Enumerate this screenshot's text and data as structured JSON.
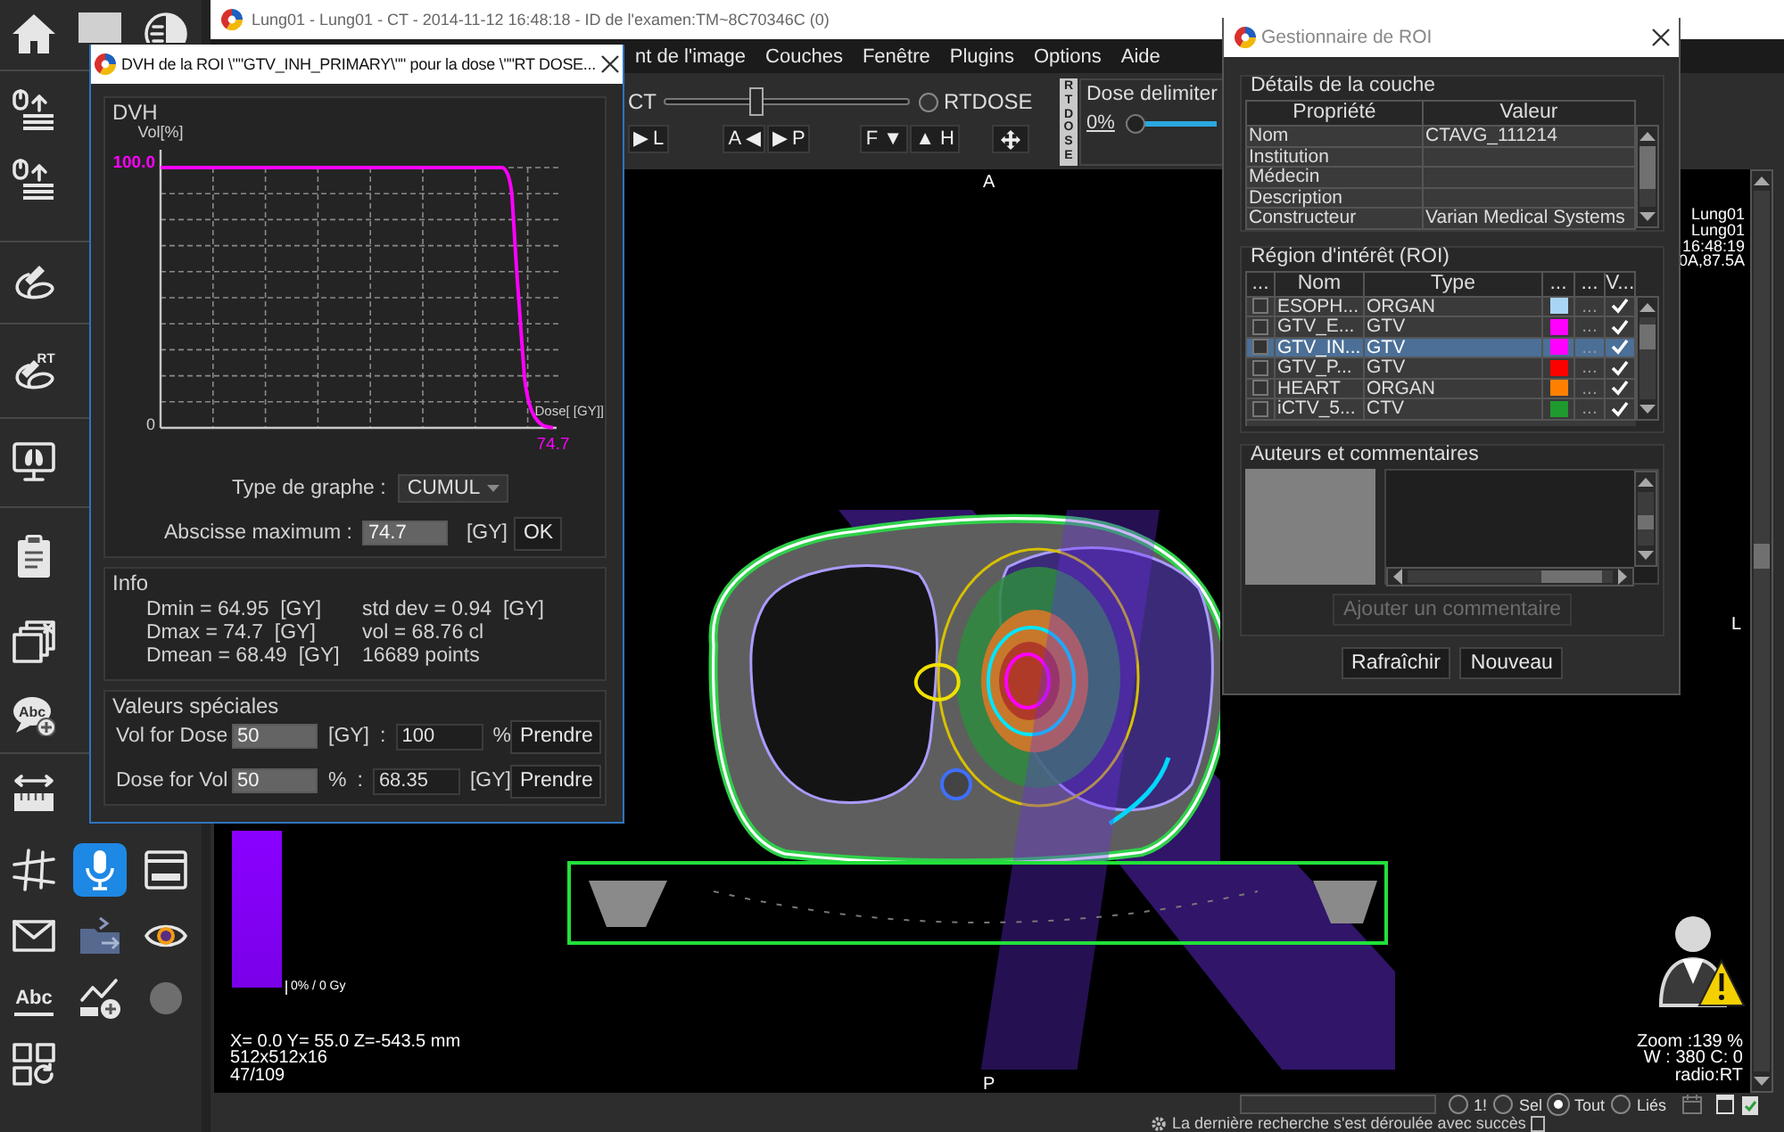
{
  "tool_palette": [
    {
      "kind": "home",
      "selected": false
    },
    {
      "kind": "square",
      "selected": false
    },
    {
      "kind": "contrast",
      "selected": false
    },
    {
      "kind": "stack-upload",
      "selected": false
    },
    {
      "kind": "stack-upload",
      "selected": false
    },
    {
      "kind": "lasso",
      "selected": false
    },
    {
      "kind": "lasso-badge",
      "label": "RT",
      "selected": false
    },
    {
      "kind": "monitor-lungs",
      "selected": false
    },
    {
      "kind": "clipboard",
      "selected": false
    },
    {
      "kind": "stack-close",
      "selected": false
    },
    {
      "kind": "text-bubble-add",
      "label": "Abc",
      "selected": false
    },
    {
      "kind": "ruler",
      "selected": false
    },
    {
      "kind": "angle",
      "selected": false
    },
    {
      "kind": "microphone",
      "selected": true
    },
    {
      "kind": "window",
      "selected": false
    },
    {
      "kind": "envelope",
      "selected": false
    },
    {
      "kind": "folder-transfer",
      "selected": false
    },
    {
      "kind": "eye",
      "selected": false
    },
    {
      "kind": "text-underline",
      "label": "Abc",
      "selected": false
    },
    {
      "kind": "chart-add",
      "selected": false
    },
    {
      "kind": "dot",
      "selected": false
    },
    {
      "kind": "grid-refresh",
      "selected": false
    }
  ],
  "viewer": {
    "title": "Lung01 - Lung01 - CT - 2014-11-12 16:48:18 - ID de l'examen:TM~8C70346C (0)",
    "menu": [
      "nt de l'image",
      "Couches",
      "Fenêtre",
      "Plugins",
      "Options",
      "Aide"
    ],
    "blend": {
      "left_label": "CT",
      "level": 0.37,
      "right_label": "RTDOSE",
      "right_selected": false
    },
    "orientation_buttons": [
      [
        "▶ L"
      ],
      [
        "A ◀",
        "▶ P"
      ],
      [
        "F ▼",
        "▲ H"
      ]
    ],
    "vertical_button": "RTDOSE",
    "dose_delimiter": {
      "title": "Dose delimiter",
      "value": "0%",
      "level": 0
    },
    "image": {
      "top_marker": "A",
      "bottom_marker": "P",
      "right_marker": "L",
      "top_right": [
        "Lung01",
        "Lung01",
        "16:48:19",
        "0A,87.5A"
      ],
      "bottom_left": [
        "X= 0.0 Y= 55.0 Z=-543.5 mm",
        "512x512x16",
        "47/109"
      ],
      "bottom_right": [
        "Zoom :139 %",
        "W : 380 C: 0",
        "radio:RT"
      ],
      "color_bar_label": "0% / 0 Gy"
    },
    "status_bar": {
      "filters": [
        {
          "label": "1!",
          "selected": false
        },
        {
          "label": "Sel",
          "selected": false
        },
        {
          "label": "Tout",
          "selected": true
        },
        {
          "label": "Liés",
          "selected": false
        }
      ],
      "message": "La dernière recherche s'est déroulée avec succès"
    }
  },
  "dvh_window": {
    "title": "DVH de la ROI \\\"\"GTV_INH_PRIMARY\\\"\" pour la dose \\\"\"RT DOSE...",
    "plot": {
      "title": "DVH",
      "y_axis_label": "Vol[%]",
      "y_top_label": "100.0",
      "y_bottom_label": "0",
      "x_axis_label": "Dose[ [GY]]",
      "x_end_label": "74.7"
    },
    "graph_type": {
      "label": "Type de graphe :",
      "value": "CUMUL"
    },
    "max_abscissa": {
      "label": "Abscisse maximum :",
      "value": "74.7",
      "unit": "[GY]",
      "button": "OK"
    },
    "info": {
      "title": "Info",
      "left": [
        "Dmin = 64.95  [GY]",
        "Dmax = 74.7  [GY]",
        "Dmean = 68.49  [GY]"
      ],
      "right": [
        "std dev = 0.94  [GY]",
        "vol = 68.76 cl",
        "16689 points"
      ]
    },
    "special_values": {
      "title": "Valeurs spéciales",
      "rows": [
        {
          "label": "Vol for Dose",
          "input": "50",
          "input_unit": "[GY]",
          "separator": ":",
          "result": "100",
          "result_unit": "%",
          "button": "Prendre"
        },
        {
          "label": "Dose for Vol",
          "input": "50",
          "input_unit": "%",
          "separator": ":",
          "result": "68.35",
          "result_unit": "[GY]",
          "button": "Prendre"
        }
      ]
    }
  },
  "roi_manager": {
    "title": "Gestionnaire de ROI",
    "layer_details": {
      "title": "Détails de la couche",
      "columns": [
        "Propriété",
        "Valeur"
      ],
      "rows": [
        {
          "property": "Nom",
          "value": "CTAVG_111214"
        },
        {
          "property": "Institution"
        },
        {
          "property": "Médecin"
        },
        {
          "property": "Description"
        },
        {
          "property": "Constructeur",
          "value": "Varian Medical Systems"
        }
      ]
    },
    "roi_list": {
      "title": "Région d'intérêt (ROI)",
      "columns": [
        "...",
        "Nom",
        "Type",
        "...",
        "...",
        "V..."
      ],
      "rows": [
        {
          "checked": false,
          "name": "ESOPH...",
          "type": "ORGAN",
          "color": "#a8d4f5",
          "column_5": "...",
          "visible": true,
          "selected": false
        },
        {
          "checked": false,
          "name": "GTV_E...",
          "type": "GTV",
          "color": "#ff00ff",
          "column_5": "...",
          "visible": true,
          "selected": false
        },
        {
          "checked": false,
          "name": "GTV_IN...",
          "type": "GTV",
          "color": "#ff00ff",
          "column_5": "...",
          "visible": true,
          "selected": true
        },
        {
          "checked": false,
          "name": "GTV_P...",
          "type": "GTV",
          "color": "#ff0000",
          "column_5": "...",
          "visible": true,
          "selected": false
        },
        {
          "checked": false,
          "name": "HEART",
          "type": "ORGAN",
          "color": "#ff8000",
          "column_5": "...",
          "visible": true,
          "selected": false
        },
        {
          "checked": false,
          "name": "iCTV_5...",
          "type": "CTV",
          "color": "#1f9a2f",
          "column_5": "...",
          "visible": true,
          "selected": false
        }
      ]
    },
    "comments": {
      "title": "Auteurs et commentaires",
      "add_button": {
        "label": "Ajouter un commentaire",
        "disabled": true
      }
    },
    "buttons": [
      "Rafraîchir",
      "Nouveau"
    ]
  }
}
